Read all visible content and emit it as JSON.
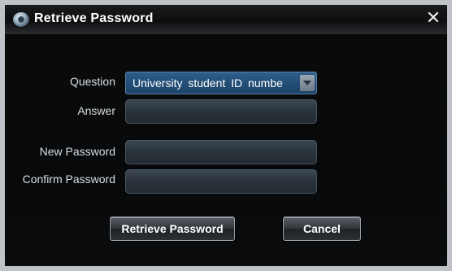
{
  "window": {
    "title": "Retrieve Password",
    "close_symbol": "✕"
  },
  "form": {
    "question_label": "Question",
    "question_value": "University  student  ID numbe",
    "answer_label": "Answer",
    "answer_value": "",
    "new_password_label": "New Password",
    "new_password_value": "",
    "confirm_password_label": "Confirm Password",
    "confirm_password_value": ""
  },
  "buttons": {
    "retrieve_label": "Retrieve Password",
    "cancel_label": "Cancel"
  },
  "icons": {
    "app": "webcam-icon",
    "close": "close-icon",
    "dropdown": "chevron-down-icon"
  },
  "colors": {
    "title_bar": "#0d0e0f",
    "dialog_body": "#0a0a0b",
    "select_accent": "#234e77",
    "input_field": "#2a333b"
  }
}
